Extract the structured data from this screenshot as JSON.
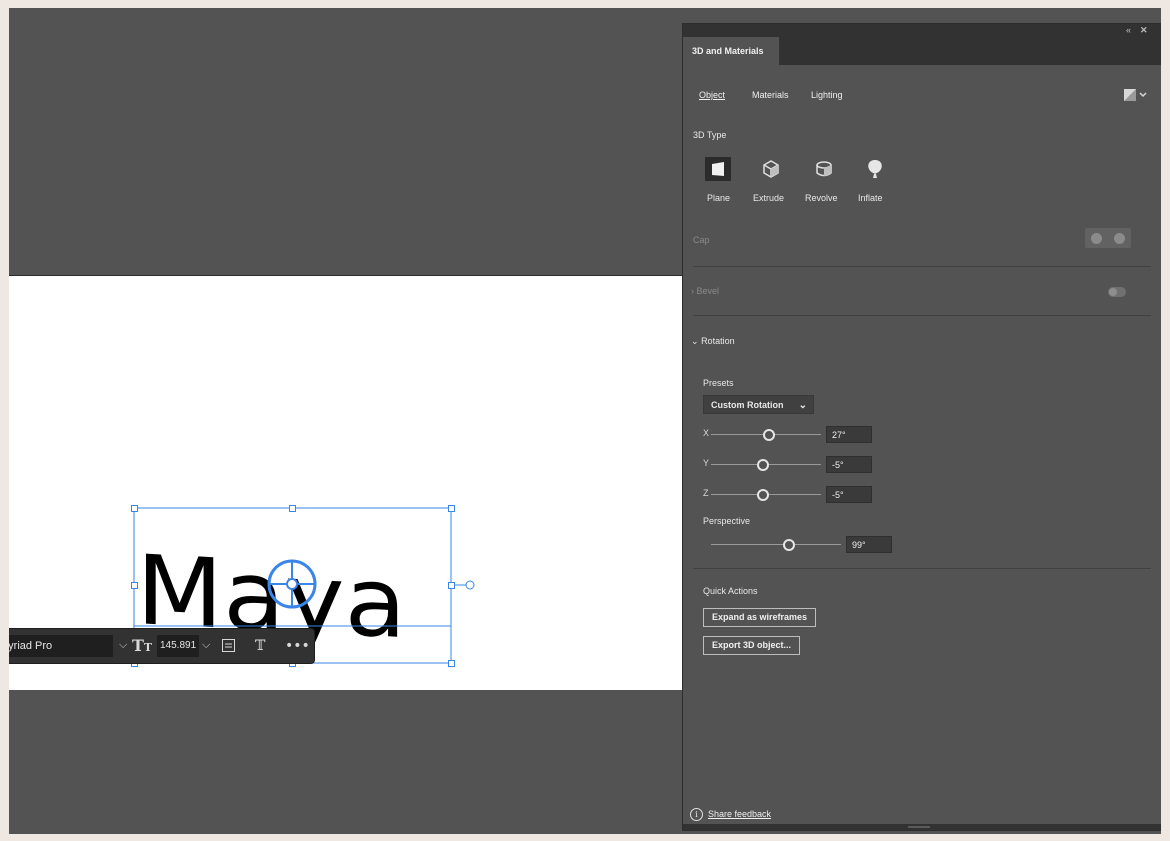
{
  "artboard": {
    "text": "Maya"
  },
  "taskbar": {
    "font_name": "Myriad Pro",
    "font_size": "145.891 pt"
  },
  "panel": {
    "title": "3D and Materials",
    "tabs": [
      {
        "label": "Object",
        "active": true
      },
      {
        "label": "Materials",
        "active": false
      },
      {
        "label": "Lighting",
        "active": false
      }
    ],
    "type_section": {
      "heading": "3D Type",
      "options": [
        {
          "label": "Plane",
          "icon": "plane-icon",
          "selected": true
        },
        {
          "label": "Extrude",
          "icon": "extrude-icon",
          "selected": false
        },
        {
          "label": "Revolve",
          "icon": "revolve-icon",
          "selected": false
        },
        {
          "label": "Inflate",
          "icon": "inflate-icon",
          "selected": false
        }
      ]
    },
    "cap_label": "Cap",
    "bevel_label": "Bevel",
    "rotation": {
      "heading": "Rotation",
      "presets_label": "Presets",
      "preset_value": "Custom Rotation",
      "x_label": "X",
      "x_value": "27°",
      "y_label": "Y",
      "y_value": "-5°",
      "z_label": "Z",
      "z_value": "-5°",
      "perspective_label": "Perspective",
      "perspective_value": "99°"
    },
    "quick_actions": {
      "heading": "Quick Actions",
      "expand_label": "Expand as wireframes",
      "export_label": "Export 3D object..."
    },
    "feedback_label": "Share feedback"
  },
  "colors": {
    "pasteboard": "#535353",
    "panel_chrome": "#323232",
    "selection": "#3a86e8"
  }
}
